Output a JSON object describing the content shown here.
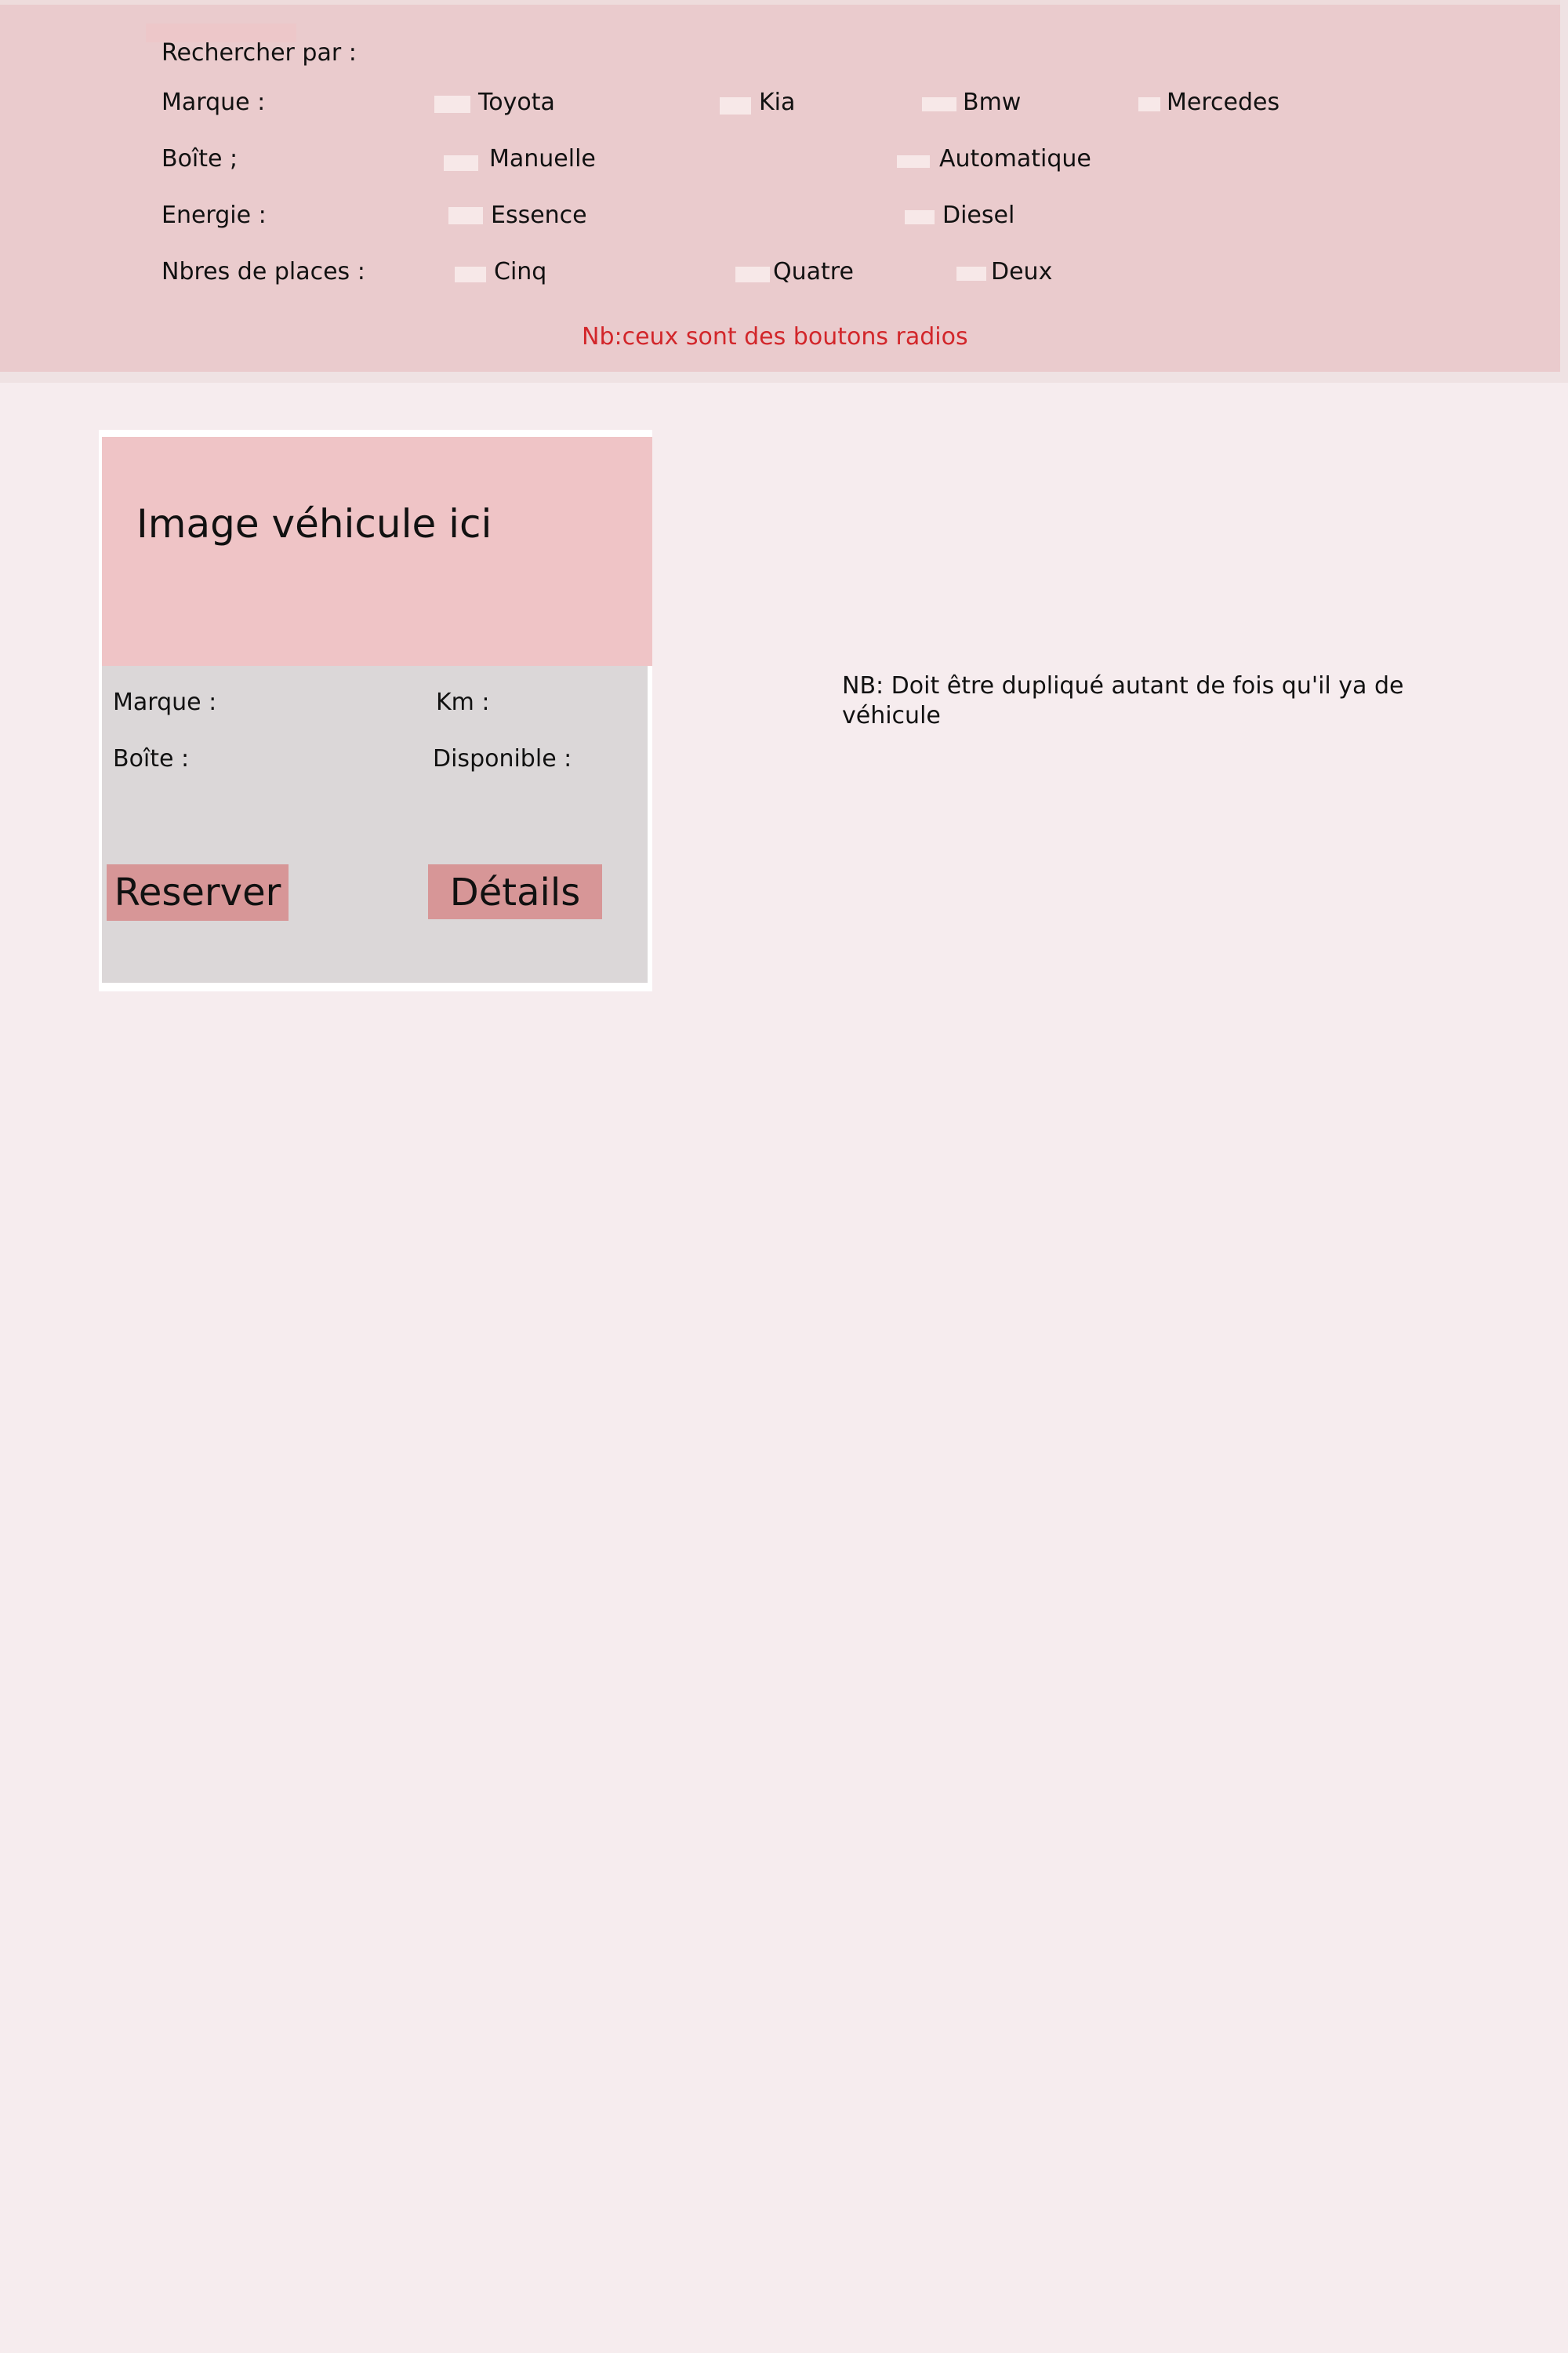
{
  "search": {
    "title": "Rechercher par :",
    "note": "Nb:ceux sont des boutons radios",
    "brand": {
      "label": "Marque :",
      "options": [
        "Toyota",
        "Kia",
        "Bmw",
        "Mercedes"
      ]
    },
    "gearbox": {
      "label": "Boîte ;",
      "options": [
        "Manuelle",
        "Automatique"
      ]
    },
    "energy": {
      "label": "Energie :",
      "options": [
        "Essence",
        "Diesel"
      ]
    },
    "seats": {
      "label": "Nbres de places :",
      "options": [
        "Cinq",
        "Quatre",
        "Deux"
      ]
    }
  },
  "card": {
    "image_placeholder": "Image véhicule ici",
    "brand_label": "Marque :",
    "km_label": "Km :",
    "gearbox_label": "Boîte :",
    "available_label": "Disponible :",
    "reserve_button": "Reserver",
    "details_button": "Détails"
  },
  "duplicate_note": "NB: Doit être dupliqué autant de fois qu'il ya de véhicule",
  "colors": {
    "panel": "#eacbcd",
    "page_bg": "#f6ecee",
    "image_bg": "#efc4c6",
    "info_bg": "#dbd7d8",
    "button": "#d79697",
    "note_red": "#d2262a"
  }
}
